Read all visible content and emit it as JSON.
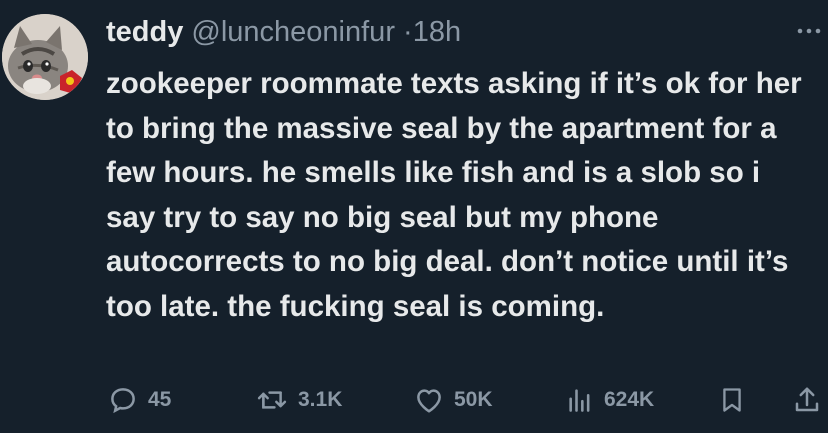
{
  "author": {
    "display_name": "teddy",
    "handle": "@luncheoninfur",
    "separator": "·",
    "timestamp": "18h"
  },
  "more_icon": "more-horizontal-icon",
  "tweet_text": "zookeeper roommate texts asking if it’s ok for her to bring the massive seal by the apartment for a few hours. he smells like fish and is a slob so i say try to say no big seal but my phone autocorrects to no big deal. don’t notice until it’s too late. the fucking seal is coming.",
  "actions": {
    "replies": "45",
    "retweets": "3.1K",
    "likes": "50K",
    "views": "624K"
  },
  "colors": {
    "background": "#15202b",
    "text": "#e7e9ea",
    "muted": "#8b98a5"
  }
}
